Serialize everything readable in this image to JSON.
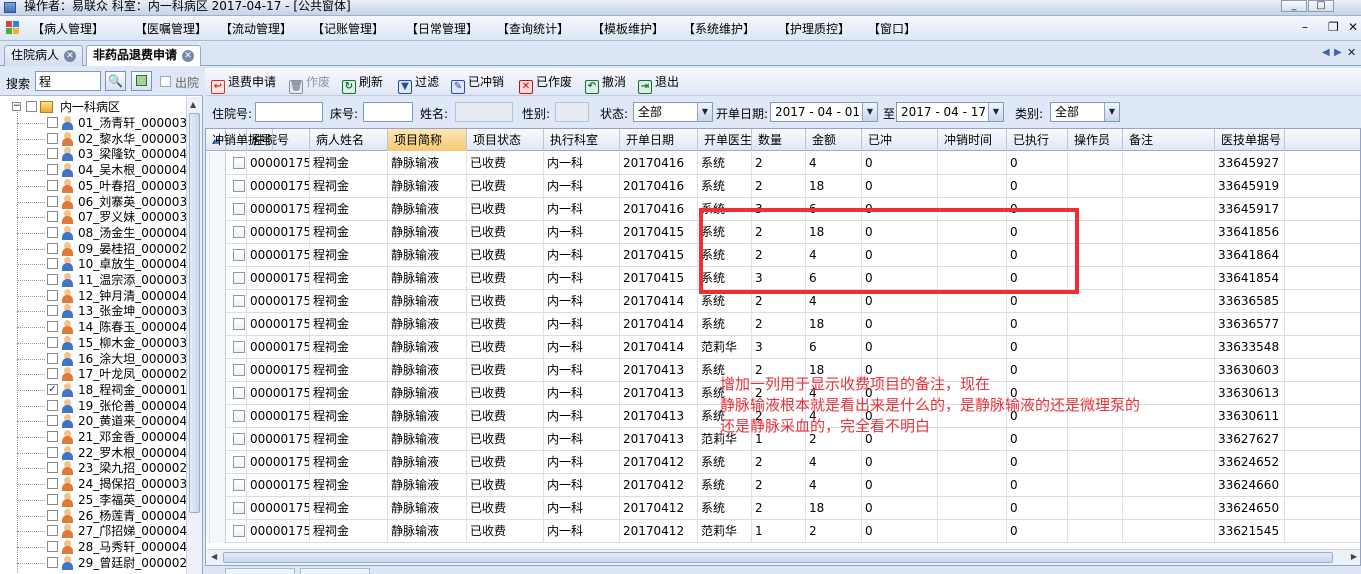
{
  "window": {
    "title": "操作者：易联众  科室：内一科病区  2017-04-17 - [公共窗体]"
  },
  "menu": [
    "【病人管理】",
    "【医嘱管理】",
    "【流动管理】",
    "【记账管理】",
    "【日常管理】",
    "【查询统计】",
    "【模板维护】",
    "【系统维护】",
    "【护理质控】",
    "【窗口】"
  ],
  "tabs": [
    {
      "label": "住院病人",
      "active": false
    },
    {
      "label": "非药品退费申请",
      "active": true
    }
  ],
  "search": {
    "label": "搜索",
    "value": "程",
    "discharge_label": "出院"
  },
  "tree": {
    "root": "内一科病区",
    "patients": [
      {
        "label": "01_汤青轩_00000370",
        "gender": "m"
      },
      {
        "label": "02_黎水华_00000308",
        "gender": "f"
      },
      {
        "label": "03_梁隆钦_00000457",
        "gender": "m"
      },
      {
        "label": "04_吴木根_00000418",
        "gender": "m"
      },
      {
        "label": "05_叶春招_00000333",
        "gender": "f"
      },
      {
        "label": "06_刘寨英_00000395",
        "gender": "f"
      },
      {
        "label": "07_罗义妹_00000380",
        "gender": "f"
      },
      {
        "label": "08_汤金生_00000428",
        "gender": "m"
      },
      {
        "label": "09_晏桂招_00000219",
        "gender": "f"
      },
      {
        "label": "10_卓放生_00000408",
        "gender": "m"
      },
      {
        "label": "11_温宗添_00000345",
        "gender": "m"
      },
      {
        "label": "12_钟月清_00000467",
        "gender": "f"
      },
      {
        "label": "13_张金坤_00000307",
        "gender": "m"
      },
      {
        "label": "14_陈春玉_00000453",
        "gender": "f"
      },
      {
        "label": "15_柳木金_00000310",
        "gender": "m"
      },
      {
        "label": "16_涂大坦_00000347",
        "gender": "m"
      },
      {
        "label": "17_叶龙凤_00000288",
        "gender": "f"
      },
      {
        "label": "18_程祠金_00000175",
        "gender": "m",
        "checked": true
      },
      {
        "label": "19_张伦善_00000411",
        "gender": "m"
      },
      {
        "label": "20_黄道来_00000456",
        "gender": "m"
      },
      {
        "label": "21_邓金香_00000469",
        "gender": "f"
      },
      {
        "label": "22_罗木根_00000407",
        "gender": "m"
      },
      {
        "label": "23_梁九招_00000269",
        "gender": "f"
      },
      {
        "label": "24_揭保招_00000353",
        "gender": "f"
      },
      {
        "label": "25_李福英_00000462",
        "gender": "f"
      },
      {
        "label": "26_杨莲青_00000420",
        "gender": "f"
      },
      {
        "label": "27_邝招娣_00000423",
        "gender": "f"
      },
      {
        "label": "28_马秀轩_00000447",
        "gender": "f"
      },
      {
        "label": "29_曾廷尉_00000299",
        "gender": "m"
      }
    ]
  },
  "toolbar": [
    {
      "label": "退费申请",
      "icon": "refund-request-icon",
      "enabled": true
    },
    {
      "label": "作废",
      "icon": "trash-icon",
      "enabled": false
    },
    {
      "label": "刷新",
      "icon": "refresh-icon",
      "enabled": true
    },
    {
      "label": "过滤",
      "icon": "filter-icon",
      "enabled": true
    },
    {
      "label": "已冲销",
      "icon": "written-off-icon",
      "enabled": true
    },
    {
      "label": "已作废",
      "icon": "voided-icon",
      "enabled": true
    },
    {
      "label": "撤消",
      "icon": "undo-icon",
      "enabled": true
    },
    {
      "label": "退出",
      "icon": "exit-icon",
      "enabled": true
    }
  ],
  "filters": {
    "admission_no_label": "住院号:",
    "admission_no": "",
    "bed_label": "床号:",
    "bed": "",
    "name_label": "姓名:",
    "name": "",
    "gender_label": "性别:",
    "gender": "",
    "status_label": "状态:",
    "status": "全部",
    "date_label": "开单日期:",
    "date_from": "2017 - 04 - 01",
    "date_to_label": "至",
    "date_to": "2017 - 04 - 17",
    "category_label": "类别:",
    "category": "全部"
  },
  "table": {
    "columns": [
      "住院号",
      "病人姓名",
      "项目简称",
      "项目状态",
      "执行科室",
      "开单日期",
      "开单医生",
      "数量",
      "金额",
      "已冲",
      "冲销时间",
      "已执行",
      "操作员",
      "备注",
      "医技单据号",
      "冲销单据号"
    ],
    "rows": [
      [
        "00000175",
        "程祠金",
        "静脉输液",
        "已收费",
        "内一科",
        "20170416",
        "系统",
        "2",
        "4",
        "0",
        "",
        "0",
        "",
        "",
        "33645927",
        ""
      ],
      [
        "00000175",
        "程祠金",
        "静脉输液",
        "已收费",
        "内一科",
        "20170416",
        "系统",
        "2",
        "18",
        "0",
        "",
        "0",
        "",
        "",
        "33645919",
        ""
      ],
      [
        "00000175",
        "程祠金",
        "静脉输液",
        "已收费",
        "内一科",
        "20170416",
        "系统",
        "3",
        "6",
        "0",
        "",
        "0",
        "",
        "",
        "33645917",
        ""
      ],
      [
        "00000175",
        "程祠金",
        "静脉输液",
        "已收费",
        "内一科",
        "20170415",
        "系统",
        "2",
        "18",
        "0",
        "",
        "0",
        "",
        "",
        "33641856",
        ""
      ],
      [
        "00000175",
        "程祠金",
        "静脉输液",
        "已收费",
        "内一科",
        "20170415",
        "系统",
        "2",
        "4",
        "0",
        "",
        "0",
        "",
        "",
        "33641864",
        ""
      ],
      [
        "00000175",
        "程祠金",
        "静脉输液",
        "已收费",
        "内一科",
        "20170415",
        "系统",
        "3",
        "6",
        "0",
        "",
        "0",
        "",
        "",
        "33641854",
        ""
      ],
      [
        "00000175",
        "程祠金",
        "静脉输液",
        "已收费",
        "内一科",
        "20170414",
        "系统",
        "2",
        "4",
        "0",
        "",
        "0",
        "",
        "",
        "33636585",
        ""
      ],
      [
        "00000175",
        "程祠金",
        "静脉输液",
        "已收费",
        "内一科",
        "20170414",
        "系统",
        "2",
        "18",
        "0",
        "",
        "0",
        "",
        "",
        "33636577",
        ""
      ],
      [
        "00000175",
        "程祠金",
        "静脉输液",
        "已收费",
        "内一科",
        "20170414",
        "范莉华",
        "3",
        "6",
        "0",
        "",
        "0",
        "",
        "",
        "33633548",
        ""
      ],
      [
        "00000175",
        "程祠金",
        "静脉输液",
        "已收费",
        "内一科",
        "20170413",
        "系统",
        "2",
        "18",
        "0",
        "",
        "0",
        "",
        "",
        "33630603",
        ""
      ],
      [
        "00000175",
        "程祠金",
        "静脉输液",
        "已收费",
        "内一科",
        "20170413",
        "系统",
        "2",
        "4",
        "0",
        "",
        "0",
        "",
        "",
        "33630613",
        ""
      ],
      [
        "00000175",
        "程祠金",
        "静脉输液",
        "已收费",
        "内一科",
        "20170413",
        "系统",
        "2",
        "4",
        "0",
        "",
        "0",
        "",
        "",
        "33630611",
        ""
      ],
      [
        "00000175",
        "程祠金",
        "静脉输液",
        "已收费",
        "内一科",
        "20170413",
        "范莉华",
        "1",
        "2",
        "0",
        "",
        "0",
        "",
        "",
        "33627627",
        ""
      ],
      [
        "00000175",
        "程祠金",
        "静脉输液",
        "已收费",
        "内一科",
        "20170412",
        "系统",
        "2",
        "4",
        "0",
        "",
        "0",
        "",
        "",
        "33624652",
        ""
      ],
      [
        "00000175",
        "程祠金",
        "静脉输液",
        "已收费",
        "内一科",
        "20170412",
        "系统",
        "2",
        "4",
        "0",
        "",
        "0",
        "",
        "",
        "33624660",
        ""
      ],
      [
        "00000175",
        "程祠金",
        "静脉输液",
        "已收费",
        "内一科",
        "20170412",
        "系统",
        "2",
        "18",
        "0",
        "",
        "0",
        "",
        "",
        "33624650",
        ""
      ],
      [
        "00000175",
        "程祠金",
        "静脉输液",
        "已收费",
        "内一科",
        "20170412",
        "范莉华",
        "1",
        "2",
        "0",
        "",
        "0",
        "",
        "",
        "33621545",
        ""
      ]
    ]
  },
  "annotation": {
    "lines": [
      "增加一列用于显示收费项目的备注，现在",
      "静脉输液根本就是看出来是什么的，是静脉输液的还是微理泵的",
      "还是静脉采血的，完全看不明白"
    ],
    "color": "#ee3035"
  }
}
